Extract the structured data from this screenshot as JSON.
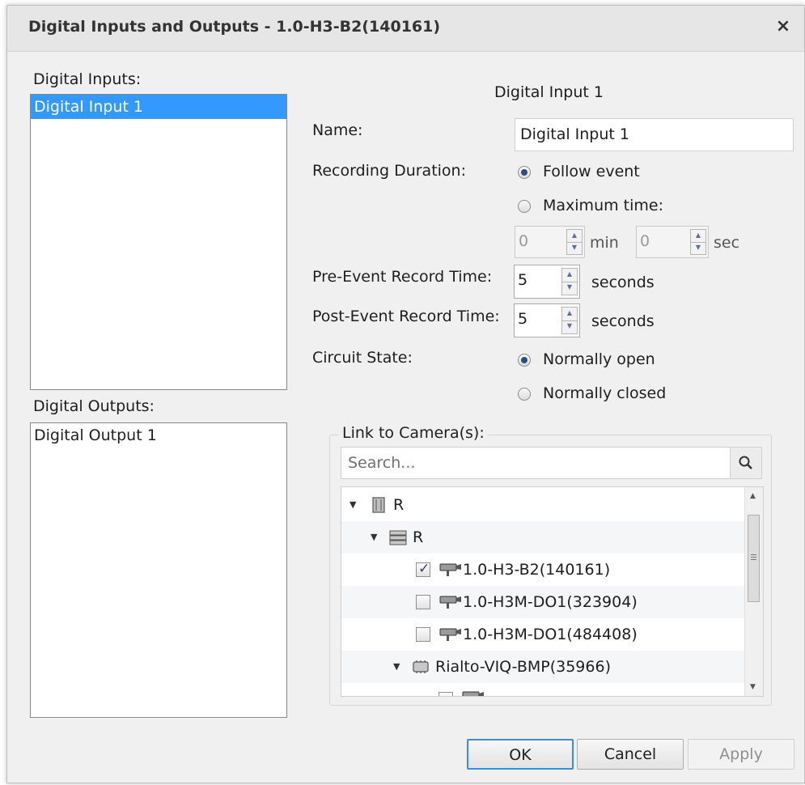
{
  "window": {
    "title": "Digital Inputs and Outputs - 1.0-H3-B2(140161)",
    "close_glyph": "×"
  },
  "inputs": {
    "label": "Digital Inputs:",
    "items": [
      "Digital Input 1"
    ]
  },
  "outputs": {
    "label": "Digital Outputs:",
    "items": [
      "Digital Output 1"
    ]
  },
  "detail": {
    "header": "Digital Input 1",
    "name_label": "Name:",
    "name_value": "Digital Input 1",
    "recording_duration_label": "Recording Duration:",
    "follow_event_label": "Follow event",
    "maximum_time_label": "Maximum time:",
    "max_min_value": "0",
    "min_unit": "min",
    "max_sec_value": "0",
    "sec_unit": "sec",
    "pre_event_label": "Pre-Event Record Time:",
    "pre_event_value": "5",
    "post_event_label": "Post-Event Record Time:",
    "post_event_value": "5",
    "seconds_unit": "seconds",
    "circuit_state_label": "Circuit State:",
    "normally_open_label": "Normally open",
    "normally_closed_label": "Normally closed"
  },
  "link_cameras": {
    "title": "Link to Camera(s):",
    "search_placeholder": "Search...",
    "tree": [
      {
        "label": "R",
        "icon": "site-icon",
        "level": 0
      },
      {
        "label": "R",
        "icon": "server-icon",
        "level": 1
      },
      {
        "label": "1.0-H3-B2(140161)",
        "icon": "camera-icon",
        "checked": true
      },
      {
        "label": "1.0-H3M-DO1(323904)",
        "icon": "camera-icon",
        "checked": false
      },
      {
        "label": "1.0-H3M-DO1(484408)",
        "icon": "camera-icon",
        "checked": false
      },
      {
        "label": "Rialto-VIQ-BMP(35966)",
        "icon": "encoder-icon",
        "level": 2
      }
    ]
  },
  "buttons": {
    "ok": "OK",
    "cancel": "Cancel",
    "apply": "Apply"
  },
  "colors": {
    "selection": "#3399ff",
    "dialog_bg": "#f0f0f0",
    "accent": "#3c8dd8"
  }
}
